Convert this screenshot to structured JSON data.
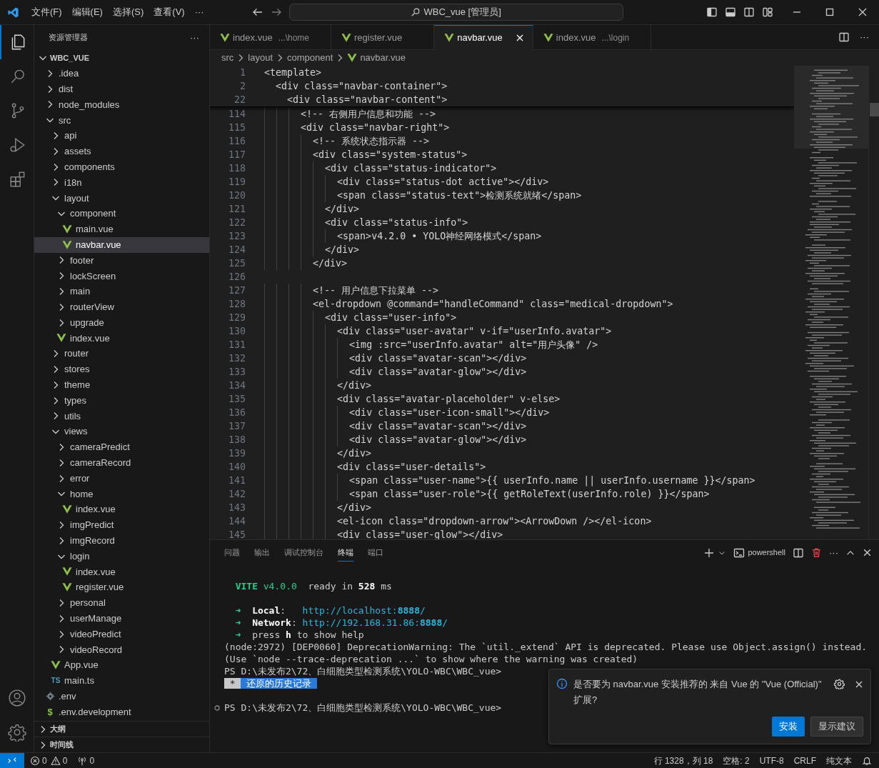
{
  "title_bar": {
    "menus": [
      "文件(F)",
      "编辑(E)",
      "选择(S)",
      "查看(V)",
      "···"
    ],
    "search": "WBC_vue [管理员]"
  },
  "activity_bar": [
    {
      "kind": "explorer",
      "selected": true
    },
    {
      "kind": "search",
      "selected": false
    },
    {
      "kind": "source-control",
      "selected": false
    },
    {
      "kind": "run-debug",
      "selected": false
    },
    {
      "kind": "extensions",
      "selected": false
    }
  ],
  "sidebar": {
    "title": "资源管理器",
    "more": "···",
    "root": {
      "label": "WBC_VUE",
      "expanded": true
    },
    "tree": [
      {
        "label": ".idea",
        "kind": "folder",
        "expanded": false,
        "selected": false
      },
      {
        "label": "dist",
        "kind": "folder",
        "expanded": false,
        "selected": false
      },
      {
        "label": "node_modules",
        "kind": "folder",
        "expanded": false,
        "selected": false
      },
      {
        "label": "src",
        "kind": "folder",
        "expanded": true,
        "selected": false,
        "children": [
          {
            "label": "api",
            "kind": "folder",
            "expanded": false,
            "selected": false
          },
          {
            "label": "assets",
            "kind": "folder",
            "expanded": false,
            "selected": false
          },
          {
            "label": "components",
            "kind": "folder",
            "expanded": false,
            "selected": false
          },
          {
            "label": "i18n",
            "kind": "folder",
            "expanded": false,
            "selected": false
          },
          {
            "label": "layout",
            "kind": "folder",
            "expanded": true,
            "selected": false,
            "children": [
              {
                "label": "component",
                "kind": "folder",
                "expanded": true,
                "selected": false,
                "children": [
                  {
                    "label": "main.vue",
                    "kind": "vue",
                    "selected": false
                  },
                  {
                    "label": "navbar.vue",
                    "kind": "vue",
                    "selected": true
                  }
                ]
              },
              {
                "label": "footer",
                "kind": "folder",
                "expanded": false,
                "selected": false
              },
              {
                "label": "lockScreen",
                "kind": "folder",
                "expanded": false,
                "selected": false
              },
              {
                "label": "main",
                "kind": "folder",
                "expanded": false,
                "selected": false
              },
              {
                "label": "routerView",
                "kind": "folder",
                "expanded": false,
                "selected": false
              },
              {
                "label": "upgrade",
                "kind": "folder",
                "expanded": false,
                "selected": false
              },
              {
                "label": "index.vue",
                "kind": "vue",
                "selected": false
              }
            ]
          },
          {
            "label": "router",
            "kind": "folder",
            "expanded": false,
            "selected": false
          },
          {
            "label": "stores",
            "kind": "folder",
            "expanded": false,
            "selected": false
          },
          {
            "label": "theme",
            "kind": "folder",
            "expanded": false,
            "selected": false
          },
          {
            "label": "types",
            "kind": "folder",
            "expanded": false,
            "selected": false
          },
          {
            "label": "utils",
            "kind": "folder",
            "expanded": false,
            "selected": false
          },
          {
            "label": "views",
            "kind": "folder",
            "expanded": true,
            "selected": false,
            "children": [
              {
                "label": "cameraPredict",
                "kind": "folder",
                "expanded": false,
                "selected": false
              },
              {
                "label": "cameraRecord",
                "kind": "folder",
                "expanded": false,
                "selected": false
              },
              {
                "label": "error",
                "kind": "folder",
                "expanded": false,
                "selected": false
              },
              {
                "label": "home",
                "kind": "folder",
                "expanded": true,
                "selected": false,
                "children": [
                  {
                    "label": "index.vue",
                    "kind": "vue",
                    "selected": false
                  }
                ]
              },
              {
                "label": "imgPredict",
                "kind": "folder",
                "expanded": false,
                "selected": false
              },
              {
                "label": "imgRecord",
                "kind": "folder",
                "expanded": false,
                "selected": false
              },
              {
                "label": "login",
                "kind": "folder",
                "expanded": true,
                "selected": false,
                "children": [
                  {
                    "label": "index.vue",
                    "kind": "vue",
                    "selected": false
                  },
                  {
                    "label": "register.vue",
                    "kind": "vue",
                    "selected": false
                  }
                ]
              },
              {
                "label": "personal",
                "kind": "folder",
                "expanded": false,
                "selected": false
              },
              {
                "label": "userManage",
                "kind": "folder",
                "expanded": false,
                "selected": false
              },
              {
                "label": "videoPredict",
                "kind": "folder",
                "expanded": false,
                "selected": false
              },
              {
                "label": "videoRecord",
                "kind": "folder",
                "expanded": false,
                "selected": false
              }
            ]
          },
          {
            "label": "App.vue",
            "kind": "vue",
            "selected": false
          },
          {
            "label": "main.ts",
            "kind": "badge",
            "badge": "TS",
            "selected": false
          }
        ]
      },
      {
        "label": ".env",
        "kind": "gear",
        "selected": false
      },
      {
        "label": ".env.development",
        "kind": "badge",
        "badge": "$",
        "selected": false
      }
    ],
    "sections": [
      {
        "label": "大纲",
        "expanded": false
      },
      {
        "label": "时间线",
        "expanded": false
      }
    ]
  },
  "tabs": [
    {
      "label": "index.vue",
      "detail": "...\\home",
      "selected": false
    },
    {
      "label": "register.vue",
      "selected": false
    },
    {
      "label": "navbar.vue",
      "selected": true
    },
    {
      "label": "index.vue",
      "detail": "...\\login",
      "selected": false
    }
  ],
  "editor_more": "···",
  "breadcrumb": [
    "src",
    "layout",
    "component",
    "navbar.vue"
  ],
  "sticky_lines": [
    {
      "number": "1",
      "text": "<template>"
    },
    {
      "number": "2",
      "text": "  <div class=\"navbar-container\">"
    },
    {
      "number": "22",
      "text": "    <div class=\"navbar-content\">"
    }
  ],
  "code_lines": [
    {
      "number": "114",
      "text": "      <!-- 右侧用户信息和功能 -->"
    },
    {
      "number": "115",
      "text": "      <div class=\"navbar-right\">"
    },
    {
      "number": "116",
      "text": "        <!-- 系统状态指示器 -->"
    },
    {
      "number": "117",
      "text": "        <div class=\"system-status\">"
    },
    {
      "number": "118",
      "text": "          <div class=\"status-indicator\">"
    },
    {
      "number": "119",
      "text": "            <div class=\"status-dot active\"></div>"
    },
    {
      "number": "120",
      "text": "            <span class=\"status-text\">检测系统就绪</span>"
    },
    {
      "number": "121",
      "text": "          </div>"
    },
    {
      "number": "122",
      "text": "          <div class=\"status-info\">"
    },
    {
      "number": "123",
      "text": "            <span>v4.2.0 • YOLO神经网络模式</span>"
    },
    {
      "number": "124",
      "text": "          </div>"
    },
    {
      "number": "125",
      "text": "        </div>"
    },
    {
      "number": "126"
    },
    {
      "number": "127",
      "text": "        <!-- 用户信息下拉菜单 -->"
    },
    {
      "number": "128",
      "text": "        <el-dropdown @command=\"handleCommand\" class=\"medical-dropdown\">"
    },
    {
      "number": "129",
      "text": "          <div class=\"user-info\">"
    },
    {
      "number": "130",
      "text": "            <div class=\"user-avatar\" v-if=\"userInfo.avatar\">"
    },
    {
      "number": "131",
      "text": "              <img :src=\"userInfo.avatar\" alt=\"用户头像\" />"
    },
    {
      "number": "132",
      "text": "              <div class=\"avatar-scan\"></div>"
    },
    {
      "number": "133",
      "text": "              <div class=\"avatar-glow\"></div>"
    },
    {
      "number": "134",
      "text": "            </div>"
    },
    {
      "number": "135",
      "text": "            <div class=\"avatar-placeholder\" v-else>"
    },
    {
      "number": "136",
      "text": "              <div class=\"user-icon-small\"></div>"
    },
    {
      "number": "137",
      "text": "              <div class=\"avatar-scan\"></div>"
    },
    {
      "number": "138",
      "text": "              <div class=\"avatar-glow\"></div>"
    },
    {
      "number": "139",
      "text": "            </div>"
    },
    {
      "number": "140",
      "text": "            <div class=\"user-details\">"
    },
    {
      "number": "141",
      "text": "              <span class=\"user-name\">{{ userInfo.name || userInfo.username }}</span>"
    },
    {
      "number": "142",
      "text": "              <span class=\"user-role\">{{ getRoleText(userInfo.role) }}</span>"
    },
    {
      "number": "143",
      "text": "            </div>"
    },
    {
      "number": "144",
      "text": "            <el-icon class=\"dropdown-arrow\"><ArrowDown /></el-icon>"
    },
    {
      "number": "145",
      "text": "            <div class=\"user-glow\"></div>"
    }
  ],
  "panel": {
    "tabs": [
      {
        "label": "问题",
        "selected": false
      },
      {
        "label": "输出",
        "selected": false
      },
      {
        "label": "调试控制台",
        "selected": false
      },
      {
        "label": "终端",
        "selected": true
      },
      {
        "label": "端口",
        "selected": false
      }
    ],
    "shell": "powershell",
    "more": "···",
    "terminal": [
      {
        "kind": "blank"
      },
      {
        "kind": "output",
        "segments": [
          {
            "text": "  VITE",
            "kind": "green-bold"
          },
          {
            "text": " v4.0.0",
            "kind": "green"
          },
          {
            "text": "  ready in ",
            "kind": "plain"
          },
          {
            "text": "528",
            "kind": "bold"
          },
          {
            "text": " ms",
            "kind": "plain"
          }
        ]
      },
      {
        "kind": "blank"
      },
      {
        "kind": "output",
        "segments": [
          {
            "text": "  ➜  ",
            "kind": "green"
          },
          {
            "text": "Local",
            "kind": "bold"
          },
          {
            "text": ":   ",
            "kind": "plain"
          },
          {
            "text": "http://localhost:",
            "kind": "cyan"
          },
          {
            "text": "8888",
            "kind": "cyan-bold"
          },
          {
            "text": "/",
            "kind": "cyan"
          }
        ]
      },
      {
        "kind": "output",
        "segments": [
          {
            "text": "  ➜  ",
            "kind": "green"
          },
          {
            "text": "Network",
            "kind": "bold"
          },
          {
            "text": ": ",
            "kind": "plain"
          },
          {
            "text": "http://192.168.31.86:",
            "kind": "cyan"
          },
          {
            "text": "8888",
            "kind": "cyan-bold"
          },
          {
            "text": "/",
            "kind": "cyan"
          }
        ]
      },
      {
        "kind": "output",
        "segments": [
          {
            "text": "  ➜  ",
            "kind": "green"
          },
          {
            "text": "press ",
            "kind": "plain"
          },
          {
            "text": "h",
            "kind": "bold"
          },
          {
            "text": " to show help",
            "kind": "plain"
          }
        ]
      },
      {
        "kind": "output",
        "segments": [
          {
            "text": "(node:2972) [DEP0060] DeprecationWarning: The `util._extend` API is deprecated. Please use Object.assign() instead.",
            "kind": "plain"
          }
        ]
      },
      {
        "kind": "output",
        "segments": [
          {
            "text": "(Use `node --trace-deprecation ...` to show where the warning was created)",
            "kind": "plain"
          }
        ]
      },
      {
        "kind": "output",
        "segments": [
          {
            "text": "PS D:\\未发布2\\72、白细胞类型检测系统\\YOLO-WBC\\WBC_vue>",
            "kind": "plain"
          }
        ]
      },
      {
        "kind": "output",
        "segments": [
          {
            "text": " * ",
            "kind": "marker"
          },
          {
            "text": " 还原的历史记录 ",
            "kind": "highlight"
          }
        ]
      },
      {
        "kind": "blank"
      },
      {
        "kind": "prompt",
        "segments": [
          {
            "text": "PS D:\\未发布2\\72、白细胞类型检测系统\\YOLO-WBC\\WBC_vue>",
            "kind": "plain"
          }
        ]
      }
    ]
  },
  "notification": {
    "message": "是否要为 navbar.vue 安装推荐的 来自 Vue 的 \"Vue (Official)\" 扩展?",
    "buttons": [
      {
        "label": "安装",
        "primary": true
      },
      {
        "label": "显示建议",
        "primary": false
      }
    ]
  },
  "status_bar": {
    "errors": "0",
    "warnings": "0",
    "ports": "0",
    "items": [
      "行 1328，列 18",
      "空格: 2",
      "UTF-8",
      "CRLF",
      "纯文本"
    ]
  }
}
